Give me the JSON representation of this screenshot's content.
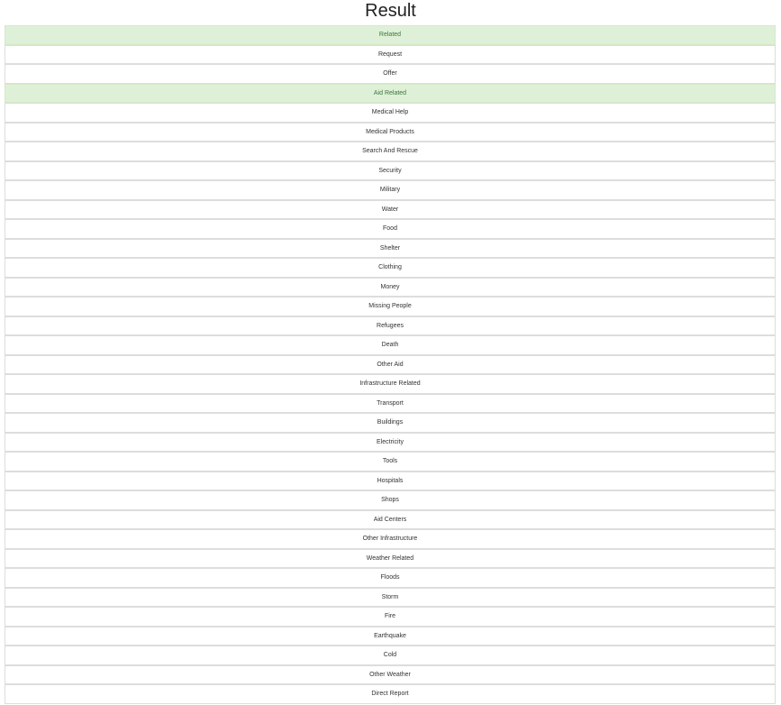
{
  "page": {
    "title": "Result"
  },
  "categories": [
    {
      "label": "Related",
      "active": true
    },
    {
      "label": "Request",
      "active": false
    },
    {
      "label": "Offer",
      "active": false
    },
    {
      "label": "Aid Related",
      "active": true
    },
    {
      "label": "Medical Help",
      "active": false
    },
    {
      "label": "Medical Products",
      "active": false
    },
    {
      "label": "Search And Rescue",
      "active": false
    },
    {
      "label": "Security",
      "active": false
    },
    {
      "label": "Military",
      "active": false
    },
    {
      "label": "Water",
      "active": false
    },
    {
      "label": "Food",
      "active": false
    },
    {
      "label": "Shelter",
      "active": false
    },
    {
      "label": "Clothing",
      "active": false
    },
    {
      "label": "Money",
      "active": false
    },
    {
      "label": "Missing People",
      "active": false
    },
    {
      "label": "Refugees",
      "active": false
    },
    {
      "label": "Death",
      "active": false
    },
    {
      "label": "Other Aid",
      "active": false
    },
    {
      "label": "Infrastructure Related",
      "active": false
    },
    {
      "label": "Transport",
      "active": false
    },
    {
      "label": "Buildings",
      "active": false
    },
    {
      "label": "Electricity",
      "active": false
    },
    {
      "label": "Tools",
      "active": false
    },
    {
      "label": "Hospitals",
      "active": false
    },
    {
      "label": "Shops",
      "active": false
    },
    {
      "label": "Aid Centers",
      "active": false
    },
    {
      "label": "Other Infrastructure",
      "active": false
    },
    {
      "label": "Weather Related",
      "active": false
    },
    {
      "label": "Floods",
      "active": false
    },
    {
      "label": "Storm",
      "active": false
    },
    {
      "label": "Fire",
      "active": false
    },
    {
      "label": "Earthquake",
      "active": false
    },
    {
      "label": "Cold",
      "active": false
    },
    {
      "label": "Other Weather",
      "active": false
    },
    {
      "label": "Direct Report",
      "active": false
    }
  ],
  "colors": {
    "active_background": "#dff0d8",
    "active_text": "#3c763d",
    "inactive_background": "#ffffff",
    "border": "#dddddd"
  }
}
